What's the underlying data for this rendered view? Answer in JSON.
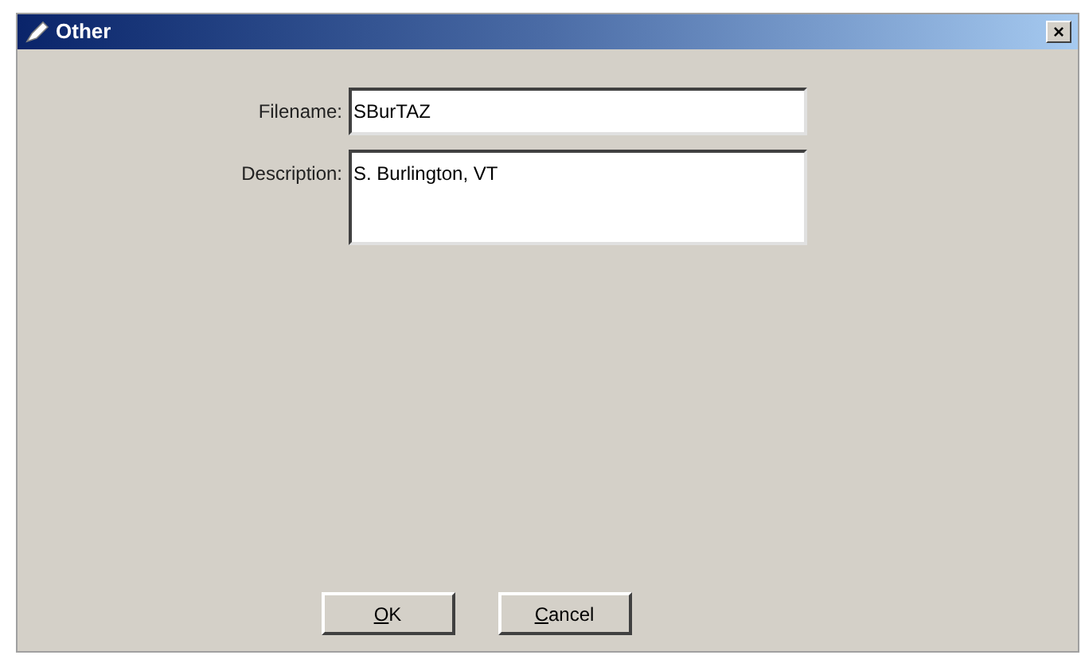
{
  "window": {
    "title": "Other",
    "close": "×"
  },
  "fields": [
    {
      "label": "Filename:",
      "value": "SBurTAZ",
      "kind": "line"
    },
    {
      "label": "Description:",
      "value": "S. Burlington, VT",
      "kind": "area"
    }
  ],
  "buttons": [
    {
      "label": "OK",
      "underline_first": true
    },
    {
      "label": "Cancel",
      "underline_first": true
    }
  ]
}
